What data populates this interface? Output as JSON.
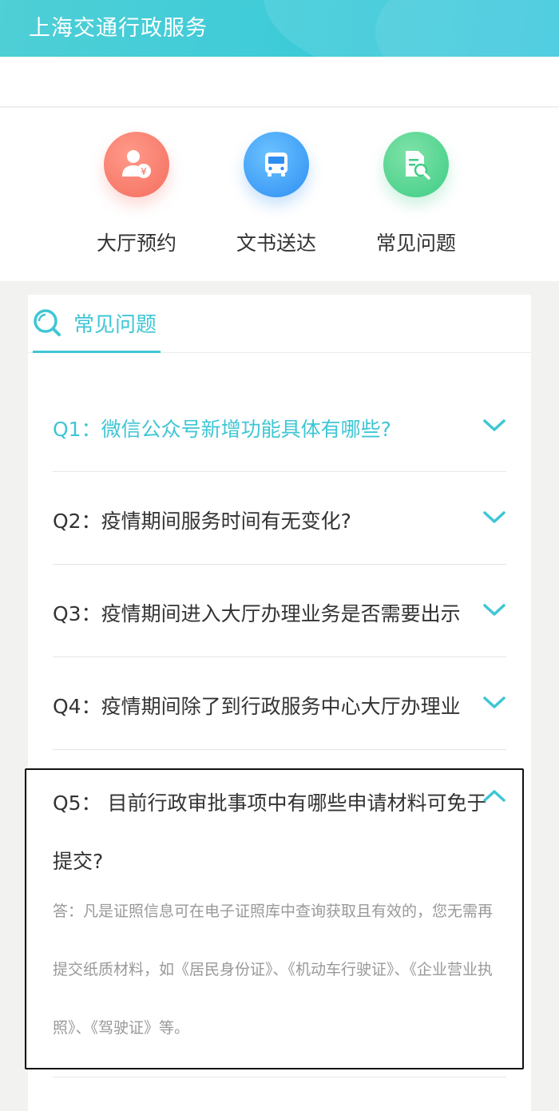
{
  "header": {
    "title": "上海交通行政服务"
  },
  "quick_links": [
    {
      "label": "大厅预约",
      "icon": "user-yen-icon",
      "color": "#f46e5e"
    },
    {
      "label": "文书送达",
      "icon": "bus-icon",
      "color": "#2d8ef2"
    },
    {
      "label": "常见问题",
      "icon": "document-search-icon",
      "color": "#3fcc85"
    }
  ],
  "faq_section": {
    "tab_label": "常见问题",
    "accent": "#3fc6d4",
    "items": [
      {
        "question": "Q1：微信公众号新增功能具体有哪些?",
        "expanded": false
      },
      {
        "question": "Q2：疫情期间服务时间有无变化?",
        "expanded": false
      },
      {
        "question": "Q3：疫情期间进入大厅办理业务是否需要出示",
        "expanded": false
      },
      {
        "question": "Q4：疫情期间除了到行政服务中心大厅办理业",
        "expanded": false
      },
      {
        "question": "Q5： 目前行政审批事项中有哪些申请材料可免于提交?",
        "expanded": true,
        "answer": "答：凡是证照信息可在电子证照库中查询获取且有效的，您无需再提交纸质材料，如《居民身份证》、《机动车行驶证》、《企业营业执照》、《驾驶证》等。"
      }
    ]
  }
}
